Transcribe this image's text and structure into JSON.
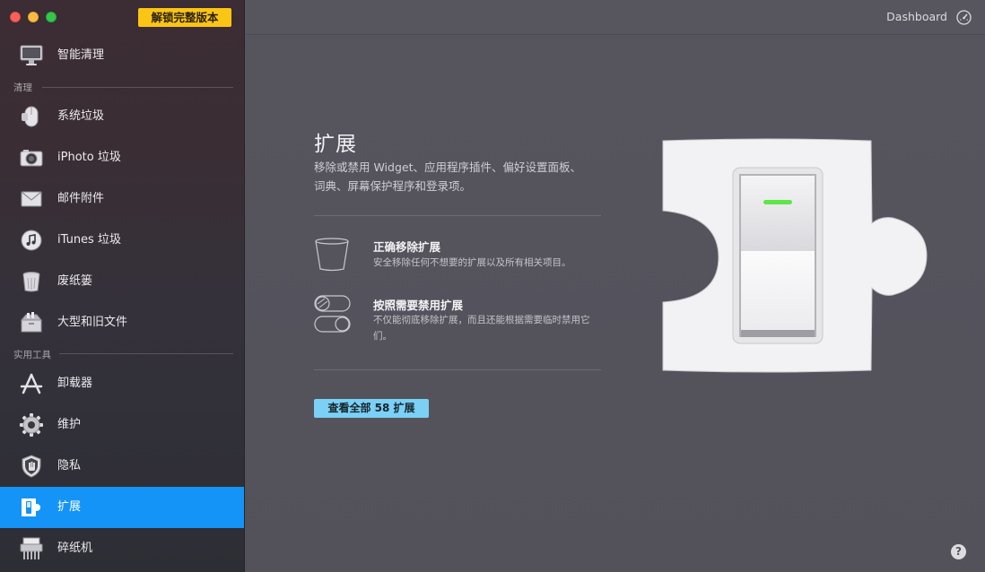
{
  "window": {
    "unlock_label": "解锁完整版本"
  },
  "sidebar": {
    "items": [
      {
        "label": "智能清理",
        "icon": "monitor-icon"
      },
      {
        "label": "系统垃圾",
        "icon": "mouse-icon"
      },
      {
        "label": "iPhoto 垃圾",
        "icon": "camera-icon"
      },
      {
        "label": "邮件附件",
        "icon": "mail-icon"
      },
      {
        "label": "iTunes 垃圾",
        "icon": "music-icon"
      },
      {
        "label": "废纸篓",
        "icon": "trash-icon"
      },
      {
        "label": "大型和旧文件",
        "icon": "box-icon"
      },
      {
        "label": "卸载器",
        "icon": "appstore-icon"
      },
      {
        "label": "维护",
        "icon": "gear-icon"
      },
      {
        "label": "隐私",
        "icon": "shield-hand-icon"
      },
      {
        "label": "扩展",
        "icon": "extension-icon",
        "active": true
      },
      {
        "label": "碎纸机",
        "icon": "shredder-icon"
      }
    ],
    "sections": [
      {
        "label": "清理"
      },
      {
        "label": "实用工具"
      }
    ]
  },
  "header": {
    "dashboard_label": "Dashboard"
  },
  "main": {
    "title": "扩展",
    "description": "移除或禁用 Widget、应用程序插件、偏好设置面板、词典、屏幕保护程序和登录项。",
    "features": [
      {
        "title": "正确移除扩展",
        "desc": "安全移除任何不想要的扩展以及所有相关项目。",
        "icon": "bin-outline-icon"
      },
      {
        "title": "按照需要禁用扩展",
        "desc": "不仅能彻底移除扩展，而且还能根据需要临时禁用它们。",
        "icon": "toggles-icon"
      }
    ],
    "view_all_label": "查看全部 58 扩展",
    "help_label": "?"
  },
  "colors": {
    "active": "#1494f6",
    "unlock": "#fbc515",
    "button": "#7bd0f5",
    "indicator": "#5ee64a"
  }
}
